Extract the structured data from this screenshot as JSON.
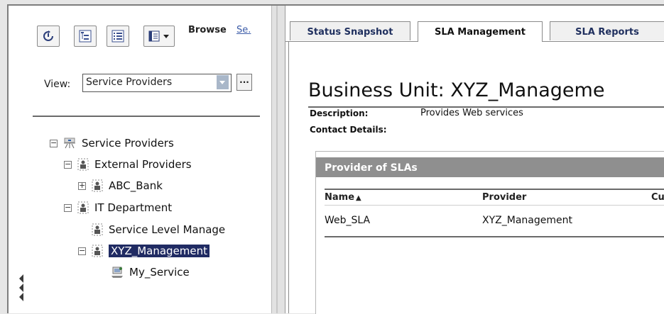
{
  "toolbar": {
    "browse_label": "Browse",
    "search_label": "Se.",
    "buttons": [
      {
        "icon": "refresh-icon"
      },
      {
        "icon": "tree-view-icon"
      },
      {
        "icon": "list-view-icon"
      },
      {
        "icon": "new-item-dropdown-icon"
      }
    ]
  },
  "view": {
    "label": "View:",
    "selected": "Service Providers",
    "more_label": "..."
  },
  "tree": {
    "nodes": [
      {
        "label": "Service Providers",
        "toggle": "−",
        "icon": "service-providers-root-icon"
      },
      {
        "label": "External Providers",
        "toggle": "−",
        "icon": "business-unit-icon"
      },
      {
        "label": "ABC_Bank",
        "toggle": "+",
        "icon": "business-unit-icon"
      },
      {
        "label": "IT Department",
        "toggle": "−",
        "icon": "business-unit-icon"
      },
      {
        "label": "Service Level Manage",
        "toggle": "",
        "icon": "business-unit-icon"
      },
      {
        "label": "XYZ_Management",
        "toggle": "−",
        "icon": "business-unit-icon",
        "selected": true
      },
      {
        "label": "My_Service",
        "toggle": "",
        "icon": "service-icon"
      }
    ]
  },
  "tabs": [
    {
      "label": "Status Snapshot",
      "active": false
    },
    {
      "label": "SLA Management",
      "active": true
    },
    {
      "label": "SLA Reports",
      "active": false
    }
  ],
  "detail": {
    "title": "Business Unit: XYZ_Manageme",
    "description_label": "Description:",
    "description_value": "Provides Web services",
    "contact_label": "Contact Details:",
    "contact_value": ""
  },
  "sla_table": {
    "header": "Provider of SLAs",
    "columns": [
      "Name",
      "Provider",
      "Cu"
    ],
    "sort_indicator": "▲",
    "rows": [
      {
        "name": "Web_SLA",
        "provider": "XYZ_Management",
        "cu": ""
      }
    ]
  },
  "colors": {
    "selection": "#202b63",
    "panel_header": "#8f8f8f",
    "tab_text": "#1f2f5e",
    "link": "#3c5ca8"
  }
}
